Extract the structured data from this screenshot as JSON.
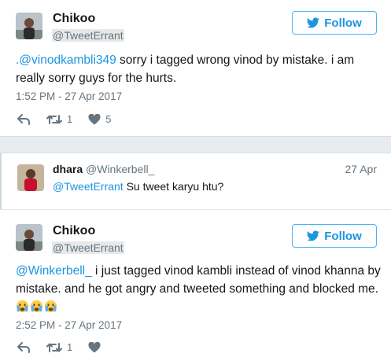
{
  "tweet1": {
    "name": "Chikoo",
    "handle": "@TweetErrant",
    "follow_label": "Follow",
    "mention": ".@vinodkambli349",
    "text_rest": " sorry i tagged wrong vinod by mistake. i am really sorry guys for the hurts.",
    "timestamp": "1:52 PM - 27 Apr 2017",
    "retweet_count": "1",
    "like_count": "5"
  },
  "reply": {
    "name": "dhara",
    "handle": "@Winkerbell_",
    "date": "27 Apr",
    "mention": "@TweetErrant",
    "text_rest": " Su tweet karyu htu?"
  },
  "tweet2": {
    "name": "Chikoo",
    "handle": "@TweetErrant",
    "follow_label": "Follow",
    "mention": "@Winkerbell_",
    "text_rest": " i just tagged vinod kambli instead of vinod khanna by mistake. and he got angry and tweeted something and blocked me.",
    "timestamp": "2:52 PM - 27 Apr 2017",
    "retweet_count": "1"
  },
  "colors": {
    "link": "#1b95e0",
    "muted": "#66757f",
    "follow_border": "#4ab3f4"
  },
  "icons": [
    "twitter-bird-icon",
    "reply-icon",
    "retweet-icon",
    "heart-icon",
    "crying-face-icon"
  ]
}
